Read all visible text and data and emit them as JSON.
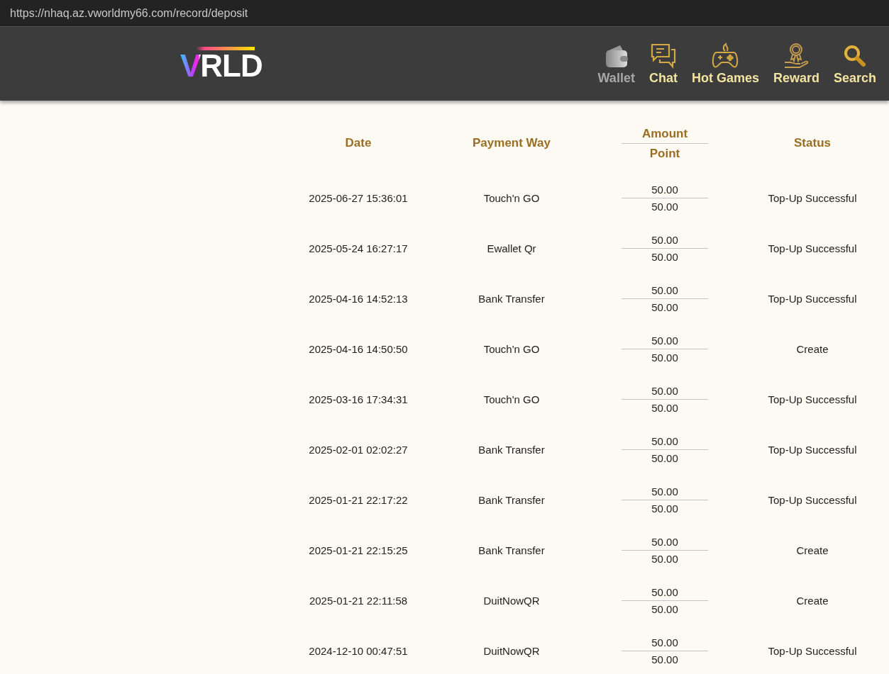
{
  "browser": {
    "url": "https://nhaq.az.vworldmy66.com/record/deposit"
  },
  "header": {
    "logo": "VRLD",
    "nav": [
      {
        "label": "Wallet",
        "kind": "wallet",
        "selected": true
      },
      {
        "label": "Chat",
        "kind": "chat",
        "selected": false
      },
      {
        "label": "Hot Games",
        "kind": "games",
        "selected": false
      },
      {
        "label": "Reward",
        "kind": "reward",
        "selected": false
      },
      {
        "label": "Search",
        "kind": "search",
        "selected": false
      }
    ]
  },
  "table": {
    "columns": [
      "Date",
      "Payment Way",
      "Amount",
      "Point",
      "Status"
    ],
    "rows": [
      {
        "date": "2025-06-27 15:36:01",
        "payment_way": "Touch'n GO",
        "amount": "50.00",
        "point": "50.00",
        "status": "Top-Up Successful"
      },
      {
        "date": "2025-05-24 16:27:17",
        "payment_way": "Ewallet Qr",
        "amount": "50.00",
        "point": "50.00",
        "status": "Top-Up Successful"
      },
      {
        "date": "2025-04-16 14:52:13",
        "payment_way": "Bank Transfer",
        "amount": "50.00",
        "point": "50.00",
        "status": "Top-Up Successful"
      },
      {
        "date": "2025-04-16 14:50:50",
        "payment_way": "Touch'n GO",
        "amount": "50.00",
        "point": "50.00",
        "status": "Create"
      },
      {
        "date": "2025-03-16 17:34:31",
        "payment_way": "Touch'n GO",
        "amount": "50.00",
        "point": "50.00",
        "status": "Top-Up Successful"
      },
      {
        "date": "2025-02-01 02:02:27",
        "payment_way": "Bank Transfer",
        "amount": "50.00",
        "point": "50.00",
        "status": "Top-Up Successful"
      },
      {
        "date": "2025-01-21 22:17:22",
        "payment_way": "Bank Transfer",
        "amount": "50.00",
        "point": "50.00",
        "status": "Top-Up Successful"
      },
      {
        "date": "2025-01-21 22:15:25",
        "payment_way": "Bank Transfer",
        "amount": "50.00",
        "point": "50.00",
        "status": "Create"
      },
      {
        "date": "2025-01-21 22:11:58",
        "payment_way": "DuitNowQR",
        "amount": "50.00",
        "point": "50.00",
        "status": "Create"
      },
      {
        "date": "2024-12-10 00:47:51",
        "payment_way": "DuitNowQR",
        "amount": "50.00",
        "point": "50.00",
        "status": "Top-Up Successful"
      }
    ]
  }
}
